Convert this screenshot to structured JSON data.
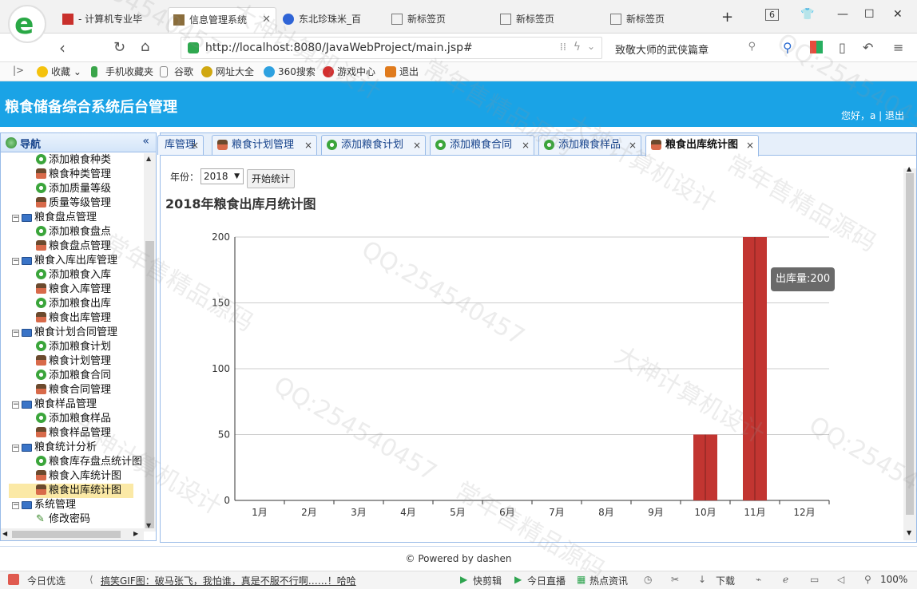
{
  "browser": {
    "tabs": [
      {
        "label": "- 计算机专业毕",
        "active": false
      },
      {
        "label": "信息管理系统",
        "active": true
      },
      {
        "label": "东北珍珠米_百",
        "active": false
      },
      {
        "label": "新标签页",
        "active": false
      },
      {
        "label": "新标签页",
        "active": false
      },
      {
        "label": "新标签页",
        "active": false
      }
    ],
    "tab_count": "6",
    "url": "http://localhost:8080/JavaWebProject/main.jsp#",
    "search_text": "致敬大师的武侠篇章",
    "favorites": [
      "收藏",
      "手机收藏夹",
      "谷歌",
      "网址大全",
      "360搜索",
      "游戏中心",
      "退出"
    ]
  },
  "app": {
    "title": "粮食储备综合系统后台管理",
    "user_greeting": "您好，a",
    "logout": "退出"
  },
  "nav": {
    "title": "导航",
    "items": [
      {
        "label": "添加粮食种类",
        "icon": "plus",
        "level": 2
      },
      {
        "label": "粮食种类管理",
        "icon": "person",
        "level": 2
      },
      {
        "label": "添加质量等级",
        "icon": "plus",
        "level": 2
      },
      {
        "label": "质量等级管理",
        "icon": "person",
        "level": 2
      },
      {
        "label": "粮食盘点管理",
        "icon": "pc",
        "level": 1
      },
      {
        "label": "添加粮食盘点",
        "icon": "plus",
        "level": 2
      },
      {
        "label": "粮食盘点管理",
        "icon": "person",
        "level": 2
      },
      {
        "label": "粮食入库出库管理",
        "icon": "pc",
        "level": 1
      },
      {
        "label": "添加粮食入库",
        "icon": "plus",
        "level": 2
      },
      {
        "label": "粮食入库管理",
        "icon": "person",
        "level": 2
      },
      {
        "label": "添加粮食出库",
        "icon": "plus",
        "level": 2
      },
      {
        "label": "粮食出库管理",
        "icon": "person",
        "level": 2
      },
      {
        "label": "粮食计划合同管理",
        "icon": "pc",
        "level": 1
      },
      {
        "label": "添加粮食计划",
        "icon": "plus",
        "level": 2
      },
      {
        "label": "粮食计划管理",
        "icon": "person",
        "level": 2
      },
      {
        "label": "添加粮食合同",
        "icon": "plus",
        "level": 2
      },
      {
        "label": "粮食合同管理",
        "icon": "person",
        "level": 2
      },
      {
        "label": "粮食样品管理",
        "icon": "pc",
        "level": 1
      },
      {
        "label": "添加粮食样品",
        "icon": "plus",
        "level": 2
      },
      {
        "label": "粮食样品管理",
        "icon": "person",
        "level": 2
      },
      {
        "label": "粮食统计分析",
        "icon": "pc",
        "level": 1
      },
      {
        "label": "粮食库存盘点统计图",
        "icon": "plus",
        "level": 2
      },
      {
        "label": "粮食入库统计图",
        "icon": "person",
        "level": 2
      },
      {
        "label": "粮食出库统计图",
        "icon": "person",
        "level": 2,
        "selected": true
      },
      {
        "label": "系统管理",
        "icon": "pc",
        "level": 1
      },
      {
        "label": "修改密码",
        "icon": "pencil",
        "level": 2
      }
    ]
  },
  "content_tabs": [
    {
      "label": "库管理",
      "icon": "none"
    },
    {
      "label": "粮食计划管理",
      "icon": "person"
    },
    {
      "label": "添加粮食计划",
      "icon": "plus"
    },
    {
      "label": "添加粮食合同",
      "icon": "plus"
    },
    {
      "label": "添加粮食样品",
      "icon": "plus"
    },
    {
      "label": "粮食出库统计图",
      "icon": "person",
      "active": true
    }
  ],
  "form": {
    "year_label": "年份：",
    "year_value": "2018",
    "submit_label": "开始统计"
  },
  "chart_data": {
    "type": "bar",
    "title": "2018年粮食出库月统计图",
    "categories": [
      "1月",
      "2月",
      "3月",
      "4月",
      "5月",
      "6月",
      "7月",
      "8月",
      "9月",
      "10月",
      "11月",
      "12月"
    ],
    "series": [
      {
        "name": "出库量",
        "values": [
          0,
          0,
          0,
          0,
          0,
          0,
          0,
          0,
          0,
          50,
          200,
          0
        ]
      }
    ],
    "ylim": [
      0,
      200
    ],
    "yticks": [
      0,
      50,
      100,
      150,
      200
    ],
    "grid": true,
    "bar_color": "#c23531",
    "tooltip": "出库量:200"
  },
  "footer": "© Powered by dashen",
  "statusbar": {
    "left": "今日优选",
    "news": "搞笑GIF图：破马张飞，我怕谁，真是不服不行啊……！哈哈",
    "items": [
      "快剪辑",
      "今日直播",
      "热点资讯",
      "下载"
    ],
    "zoom": "100%"
  },
  "watermarks": [
    "QQ:254540457",
    "大神计算机设计",
    "常年售精品源码"
  ]
}
